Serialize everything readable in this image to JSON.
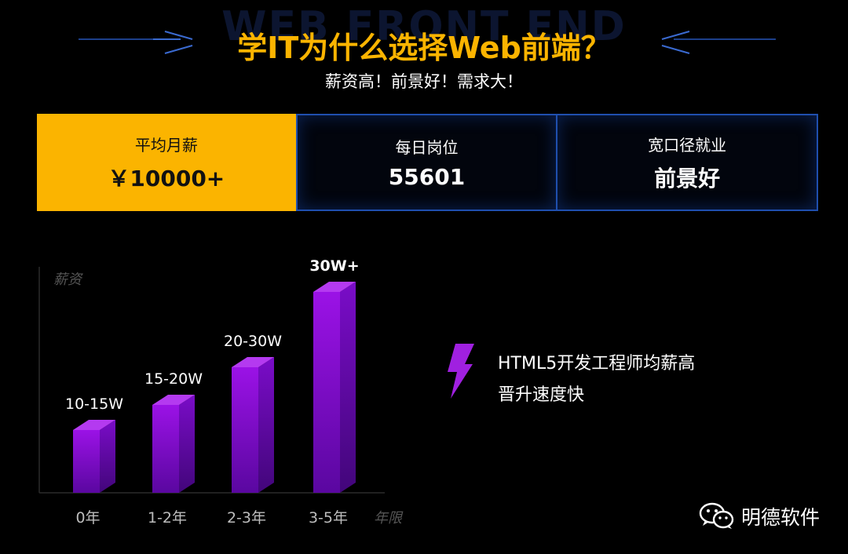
{
  "header": {
    "bg_word": "WEB FRONT END",
    "title": "学IT为什么选择Web前端？",
    "subtitle": "薪资高！前景好！需求大！"
  },
  "stats": [
    {
      "label": "平均月薪",
      "value": "￥10000+"
    },
    {
      "label": "每日岗位",
      "value": "55601"
    },
    {
      "label": "宽口径就业",
      "value": "前景好"
    }
  ],
  "chart_data": {
    "type": "bar",
    "categories": [
      "0年",
      "1-2年",
      "2-3年",
      "3-5年"
    ],
    "values": [
      12.5,
      17.5,
      25,
      40
    ],
    "data_labels": [
      "10-15W",
      "15-20W",
      "20-30W",
      "30W+"
    ],
    "ylabel": "薪资",
    "xlabel": "年限",
    "ylim": [
      0,
      45
    ],
    "grid": false,
    "colors": {
      "top": "#9b1ce0",
      "front": "#8a10d8",
      "side": "#6a05a8"
    }
  },
  "feature": {
    "lines": [
      "HTML5开发工程师均薪高",
      "晋升速度快"
    ],
    "icon": "lightning-bolt-icon",
    "icon_color": "#a020e0"
  },
  "brand": {
    "name": "明德软件",
    "icon": "wechat-icon"
  },
  "colors": {
    "accent": "#fbb400",
    "panel_border": "#1f4fae",
    "background": "#000000"
  }
}
